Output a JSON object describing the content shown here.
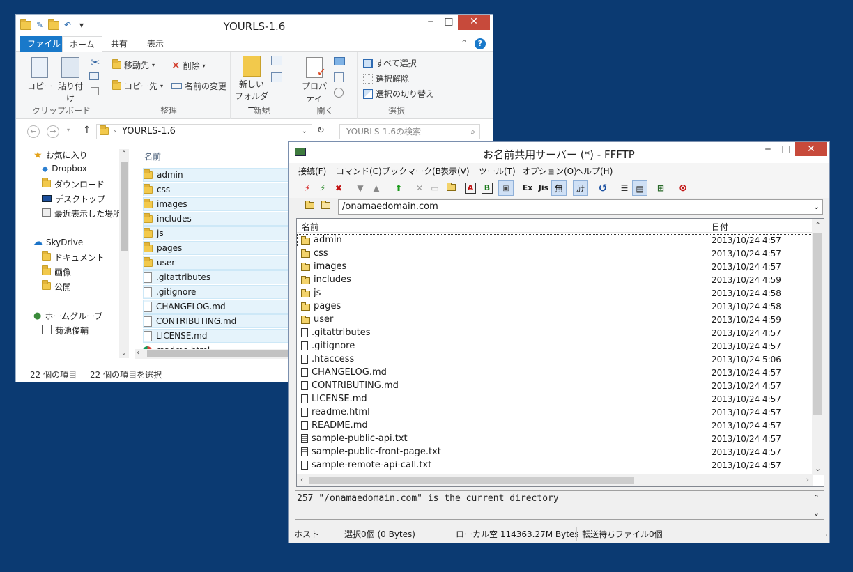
{
  "explorer": {
    "title": "YOURLS-1.6",
    "tabs": {
      "file": "ファイル",
      "home": "ホーム",
      "share": "共有",
      "view": "表示"
    },
    "ribbon": {
      "clipboard": {
        "copy": "コピー",
        "paste": "貼り付け",
        "group": "クリップボード"
      },
      "organize": {
        "move_to": "移動先",
        "copy_to": "コピー先",
        "delete": "削除",
        "rename": "名前の変更",
        "group": "整理"
      },
      "new": {
        "new_folder": "新しい\nフォルダー",
        "new_folder_l1": "新しい",
        "new_folder_l2": "フォルダー",
        "group": "新規"
      },
      "open": {
        "properties": "プロパティ",
        "group": "開く"
      },
      "select": {
        "select_all": "すべて選択",
        "select_none": "選択解除",
        "invert": "選択の切り替え",
        "group": "選択"
      }
    },
    "address": {
      "path": "YOURLS-1.6",
      "search_placeholder": "YOURLS-1.6の検索"
    },
    "nav": {
      "favorites": "お気に入り",
      "favorites_items": [
        "Dropbox",
        "ダウンロード",
        "デスクトップ",
        "最近表示した場所"
      ],
      "skydrive": "SkyDrive",
      "skydrive_items": [
        "ドキュメント",
        "画像",
        "公開"
      ],
      "homegroup": "ホームグループ",
      "homegroup_items": [
        "菊池俊輔"
      ]
    },
    "list_header": "名前",
    "files": [
      {
        "name": "admin",
        "type": "folder"
      },
      {
        "name": "css",
        "type": "folder"
      },
      {
        "name": "images",
        "type": "folder"
      },
      {
        "name": "includes",
        "type": "folder"
      },
      {
        "name": "js",
        "type": "folder"
      },
      {
        "name": "pages",
        "type": "folder"
      },
      {
        "name": "user",
        "type": "folder"
      },
      {
        "name": ".gitattributes",
        "type": "file"
      },
      {
        "name": ".gitignore",
        "type": "file"
      },
      {
        "name": "CHANGELOG.md",
        "type": "file"
      },
      {
        "name": "CONTRIBUTING.md",
        "type": "file"
      },
      {
        "name": "LICENSE.md",
        "type": "file"
      },
      {
        "name": "readme.html",
        "type": "html"
      }
    ],
    "status": {
      "count": "22 個の項目",
      "selected": "22 個の項目を選択"
    }
  },
  "ffftp": {
    "title": "お名前共用サーバー (*) - FFFTP",
    "menu": [
      "接続(F)",
      "コマンド(C)",
      "ブックマーク(B)",
      "表示(V)",
      "ツール(T)",
      "オプション(O)",
      "ヘルプ(H)"
    ],
    "toolbar": {
      "ascii": "A",
      "binary": "B",
      "ex": "Ex",
      "jis": "Jis",
      "none": "無",
      "kana": "ｶﾅ"
    },
    "path": "/onamaedomain.com",
    "columns": {
      "name": "名前",
      "date": "日付"
    },
    "files": [
      {
        "name": "admin",
        "type": "folder",
        "date": "2013/10/24  4:57"
      },
      {
        "name": "css",
        "type": "folder",
        "date": "2013/10/24  4:57"
      },
      {
        "name": "images",
        "type": "folder",
        "date": "2013/10/24  4:57"
      },
      {
        "name": "includes",
        "type": "folder",
        "date": "2013/10/24  4:59"
      },
      {
        "name": "js",
        "type": "folder",
        "date": "2013/10/24  4:58"
      },
      {
        "name": "pages",
        "type": "folder",
        "date": "2013/10/24  4:58"
      },
      {
        "name": "user",
        "type": "folder",
        "date": "2013/10/24  4:59"
      },
      {
        "name": ".gitattributes",
        "type": "file",
        "date": "2013/10/24  4:57"
      },
      {
        "name": ".gitignore",
        "type": "file",
        "date": "2013/10/24  4:57"
      },
      {
        "name": ".htaccess",
        "type": "file",
        "date": "2013/10/24  5:06"
      },
      {
        "name": "CHANGELOG.md",
        "type": "file",
        "date": "2013/10/24  4:57"
      },
      {
        "name": "CONTRIBUTING.md",
        "type": "file",
        "date": "2013/10/24  4:57"
      },
      {
        "name": "LICENSE.md",
        "type": "file",
        "date": "2013/10/24  4:57"
      },
      {
        "name": "readme.html",
        "type": "file",
        "date": "2013/10/24  4:57"
      },
      {
        "name": "README.md",
        "type": "file",
        "date": "2013/10/24  4:57"
      },
      {
        "name": "sample-public-api.txt",
        "type": "txt",
        "date": "2013/10/24  4:57"
      },
      {
        "name": "sample-public-front-page.txt",
        "type": "txt",
        "date": "2013/10/24  4:57"
      },
      {
        "name": "sample-remote-api-call.txt",
        "type": "txt",
        "date": "2013/10/24  4:57"
      }
    ],
    "log": "257 \"/onamaedomain.com\" is the current directory",
    "status": {
      "host": "ホスト",
      "selected": "選択0個 (0 Bytes)",
      "local": "ローカル空 114363.27M Bytes",
      "queue": "転送待ちファイル0個"
    }
  }
}
